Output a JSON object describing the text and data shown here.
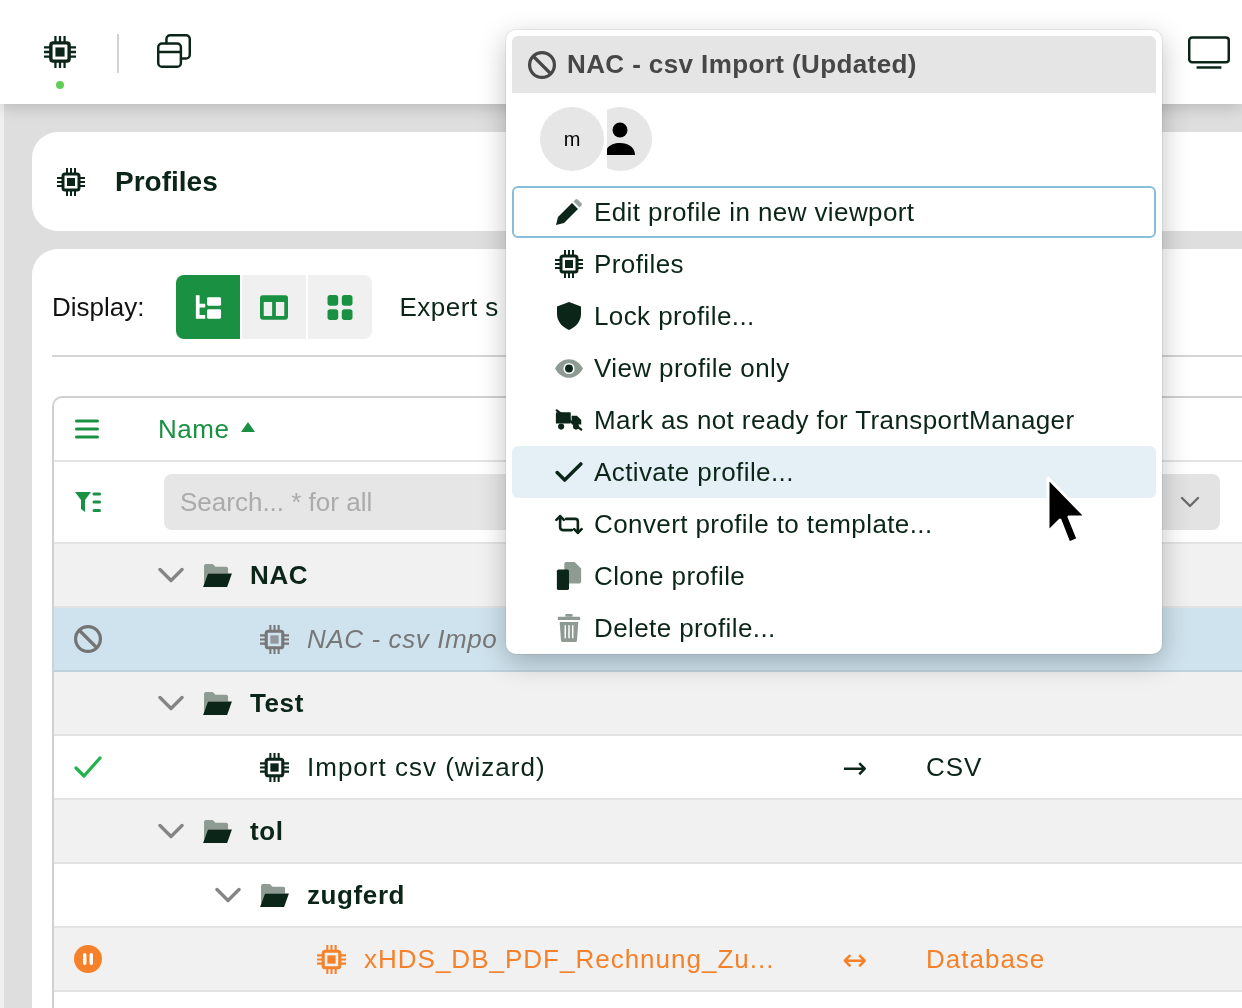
{
  "top_bar": {
    "tools": [
      {
        "kind": "profiles",
        "selected": true
      },
      {
        "kind": "windows",
        "selected": false
      }
    ]
  },
  "header": {
    "title": "Profiles"
  },
  "toolbar": {
    "label": "Display:",
    "views": [
      {
        "kind": "tree",
        "selected": true
      },
      {
        "kind": "columns",
        "selected": false
      },
      {
        "kind": "tiles",
        "selected": false
      }
    ],
    "expert_label": "Expert s"
  },
  "table": {
    "columns": [
      {
        "label": "Name",
        "sorted": true,
        "ascending": true
      }
    ],
    "search": {
      "placeholder": "Search... * for all"
    },
    "rows": [
      {
        "kind": "folder",
        "name": "NAC",
        "expanded": true,
        "selected": false,
        "children": [
          {
            "kind": "profile",
            "name": "NAC - csv Impo",
            "disabled": true,
            "paused": false,
            "selected": true
          }
        ]
      },
      {
        "kind": "folder",
        "name": "Test",
        "expanded": true,
        "selected": false,
        "children": [
          {
            "kind": "profile",
            "name": "Import csv (wizard)",
            "disabled": false,
            "paused": false,
            "selected": false,
            "direction": "→",
            "target": "CSV"
          }
        ]
      },
      {
        "kind": "folder",
        "name": "tol",
        "expanded": true,
        "selected": false,
        "children": [
          {
            "kind": "folder",
            "name": "zugferd",
            "expanded": true,
            "selected": false,
            "children": [
              {
                "kind": "profile",
                "name": "xHDS_DB_PDF_Rechnung_Zu...",
                "disabled": false,
                "paused": true,
                "selected": false,
                "direction": "↔",
                "target": "Database"
              }
            ]
          }
        ]
      }
    ]
  },
  "context_menu": {
    "disabled": true,
    "title": "NAC - csv Import (Updated)",
    "avatars": [
      {
        "kind": "initial",
        "label": "m"
      },
      {
        "kind": "person"
      }
    ],
    "items": [
      {
        "kind": "edit",
        "label": "Edit profile in new viewport",
        "focused": true,
        "hovered": false
      },
      {
        "kind": "profiles",
        "label": "Profiles",
        "focused": false,
        "hovered": false
      },
      {
        "kind": "lock",
        "label": "Lock profile...",
        "focused": false,
        "hovered": false
      },
      {
        "kind": "view",
        "label": "View profile only",
        "focused": false,
        "hovered": false
      },
      {
        "kind": "transport",
        "label": "Mark as not ready for TransportManager",
        "focused": false,
        "hovered": false
      },
      {
        "kind": "activate",
        "label": "Activate profile...",
        "focused": false,
        "hovered": true
      },
      {
        "kind": "convert",
        "label": "Convert profile to template...",
        "focused": false,
        "hovered": false
      },
      {
        "kind": "clone",
        "label": "Clone profile",
        "focused": false,
        "hovered": false
      },
      {
        "kind": "delete",
        "label": "Delete profile...",
        "focused": false,
        "hovered": false
      }
    ]
  }
}
